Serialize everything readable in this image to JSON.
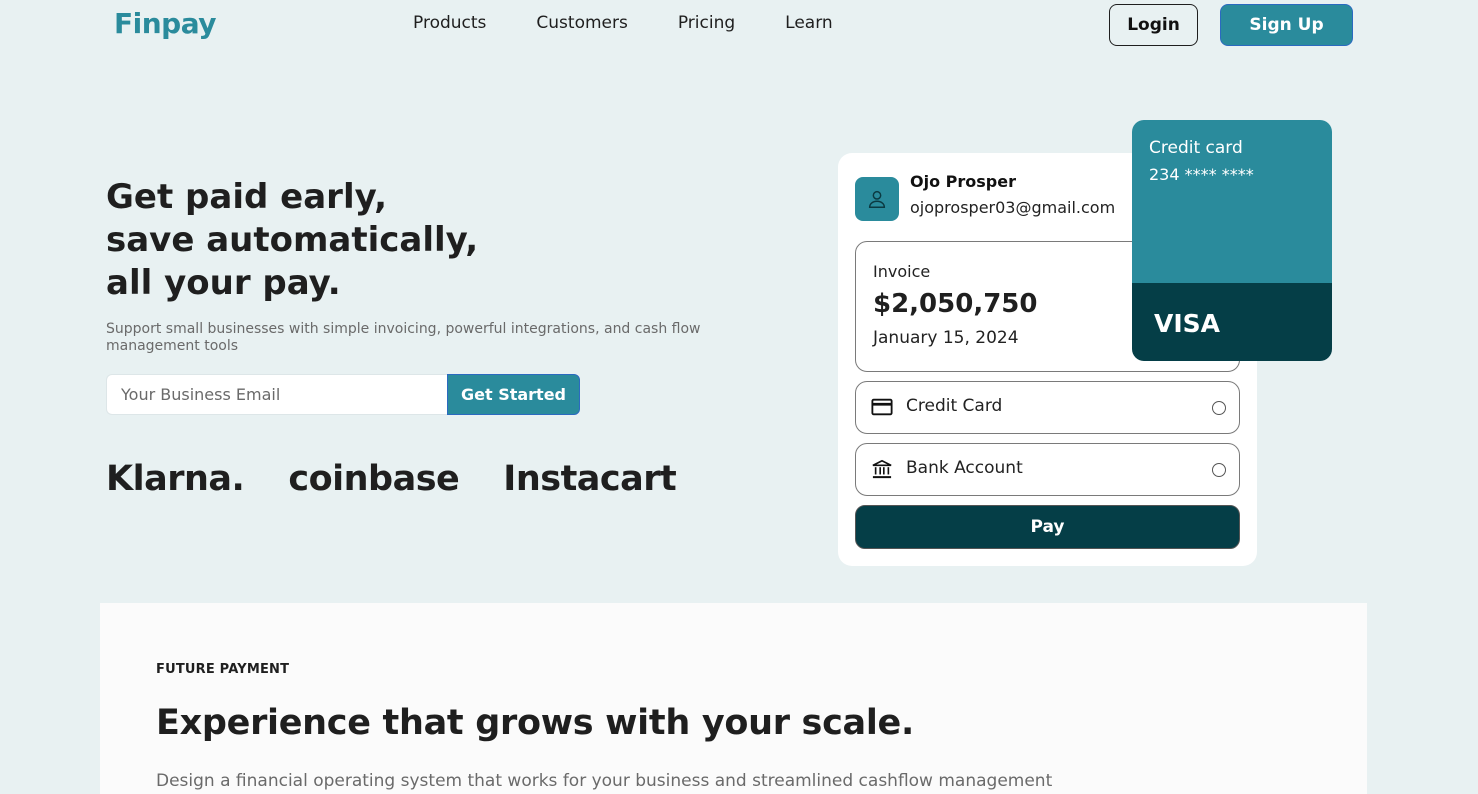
{
  "nav": {
    "logo": "Finpay",
    "links": [
      "Products",
      "Customers",
      "Pricing",
      "Learn"
    ],
    "login_label": "Login",
    "signup_label": "Sign Up"
  },
  "hero": {
    "title_line1": "Get paid early,",
    "title_line2": "save automatically,",
    "title_line3": "all your pay.",
    "subtitle": "Support small businesses with simple invoicing, powerful integrations, and cash flow management tools",
    "email_placeholder": "Your Business Email",
    "cta_label": "Get Started",
    "brands": [
      "Klarna.",
      "coinbase",
      "Instacart"
    ]
  },
  "payment": {
    "user_name": "Ojo Prosper",
    "user_email": "ojoprosper03@gmail.com",
    "invoice_label": "Invoice",
    "invoice_amount": "$2,050,750",
    "invoice_date": "January 15, 2024",
    "methods": [
      {
        "label": "Credit Card",
        "icon": "credit-card-icon"
      },
      {
        "label": "Bank Account",
        "icon": "bank-icon"
      }
    ],
    "pay_label": "Pay"
  },
  "credit_card": {
    "title": "Credit card",
    "number": "234 **** ****",
    "brand": "VISA"
  },
  "feature": {
    "eyebrow": "FUTURE PAYMENT",
    "title": "Experience that grows with your scale.",
    "description": "Design a financial operating system that works for your business and streamlined cashflow management"
  },
  "colors": {
    "accent": "#2a8b9c",
    "dark": "#053e47",
    "background": "#e8f1f2"
  }
}
